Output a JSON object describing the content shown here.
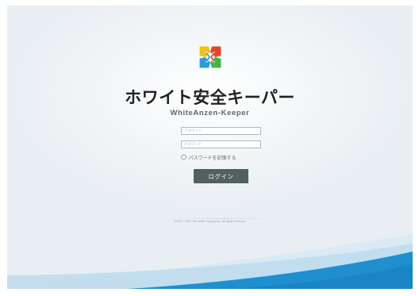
{
  "app": {
    "title": "ホワイト安全キーパー",
    "subtitle": "WhiteAnzen-Keeper",
    "logo_icon": "four-arrows-cross-logo",
    "brand_colors": {
      "yellow": "#f2c21b",
      "green": "#43b34a",
      "blue": "#2d9bd8",
      "red": "#e4452f",
      "wave_blue": "#1f8fd0",
      "button": "#52605f"
    }
  },
  "form": {
    "account_placeholder": "アカウント",
    "password_placeholder": "パスワード",
    "remember_label": "パスワードを記憶する",
    "login_label": "ログイン"
  },
  "footer": {
    "copyright": "©2019 - 2021 Tele-white Corporation. All rights reserved."
  }
}
